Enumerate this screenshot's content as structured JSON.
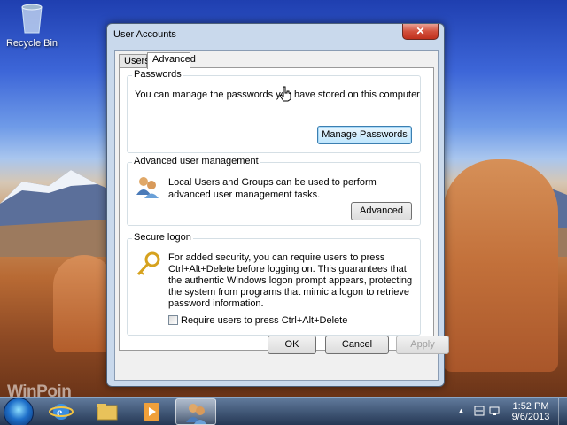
{
  "desktop": {
    "recycle_bin_label": "Recycle Bin",
    "watermark": "WinPoin"
  },
  "window": {
    "title": "User Accounts",
    "close_glyph": "✕",
    "tabs": [
      {
        "label": "Users",
        "active": false
      },
      {
        "label": "Advanced",
        "active": true
      }
    ],
    "passwords": {
      "heading": "Passwords",
      "text": "You can manage the passwords you have stored on this computer",
      "button": "Manage Passwords"
    },
    "advanced_management": {
      "heading": "Advanced user management",
      "text": "Local Users and Groups can be used to perform advanced user management tasks.",
      "button": "Advanced"
    },
    "secure_logon": {
      "heading": "Secure logon",
      "text": "For added security, you can require users to press Ctrl+Alt+Delete before logging on. This guarantees that the authentic Windows logon prompt appears, protecting the system from programs that mimic a logon to retrieve password information.",
      "checkbox_label": "Require users to press Ctrl+Alt+Delete",
      "checkbox_checked": false
    },
    "buttons": {
      "ok": "OK",
      "cancel": "Cancel",
      "apply": "Apply"
    }
  },
  "taskbar": {
    "items": [
      "start-orb",
      "internet-explorer-icon",
      "windows-explorer-icon",
      "media-player-icon",
      "user-accounts-icon"
    ],
    "tray_arrow": "▲",
    "time": "1:52 PM",
    "date": "9/6/2013"
  }
}
